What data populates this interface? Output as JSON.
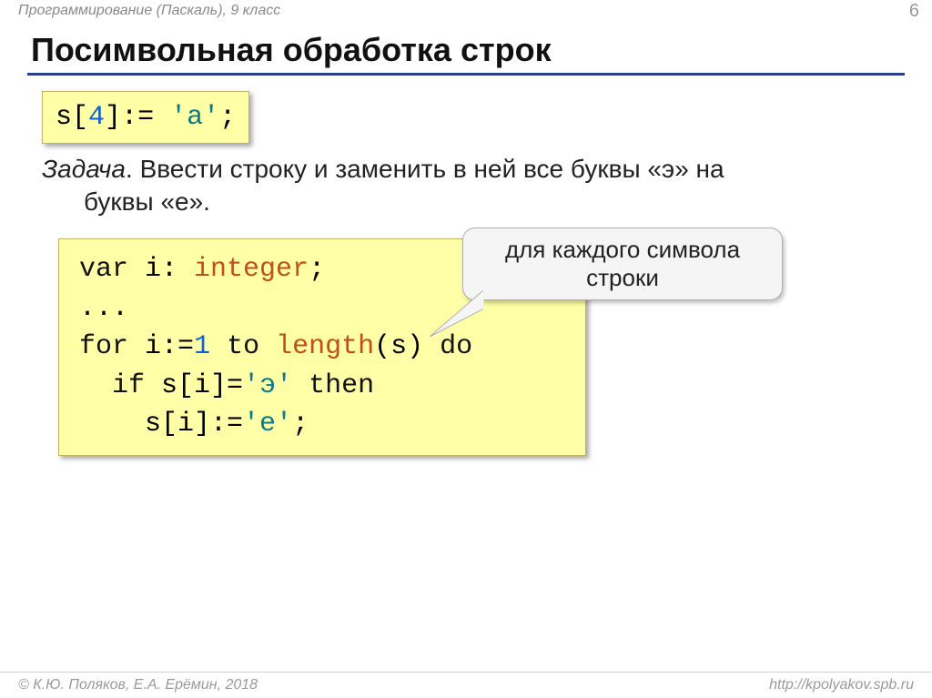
{
  "header": {
    "course": "Программирование (Паскаль), 9 класс",
    "page_number": "6"
  },
  "title": "Посимвольная обработка строк",
  "snippet1": {
    "s": "s",
    "lbracket": "[",
    "idx": "4",
    "rbracket": "]",
    "assign": ":= ",
    "qopen": "'",
    "ch": "а",
    "qclose": "'",
    "semi": ";"
  },
  "task": {
    "label": "Задача",
    "dot_space": ". ",
    "text1": "Ввести строку и заменить в ней все буквы «э» на",
    "text2": "буквы «е»."
  },
  "snippet2": {
    "l1_var": "var",
    "l1_sp1": " ",
    "l1_i": "i: ",
    "l1_type": "integer",
    "l1_semi": ";",
    "l2_dots": "...",
    "l3_for": "for",
    "l3_sp1": " ",
    "l3_ieq": "i:=",
    "l3_one": "1",
    "l3_sp2": " ",
    "l3_to": "to",
    "l3_sp3": " ",
    "l3_len": "length",
    "l3_par": "(s) ",
    "l3_do": "do",
    "l4_indent": "  ",
    "l4_if": "if",
    "l4_sp1": " ",
    "l4_si": "s[i]=",
    "l4_q1": "'э'",
    "l4_sp2": " ",
    "l4_then": "then",
    "l5_indent": "    ",
    "l5_si": "s[i]:=",
    "l5_q": "'е'",
    "l5_semi": ";"
  },
  "callout": {
    "line1": "для каждого символа",
    "line2": "строки"
  },
  "footer": {
    "copyright": "© К.Ю. Поляков, Е.А. Ерёмин, 2018",
    "url": "http://kpolyakov.spb.ru"
  }
}
